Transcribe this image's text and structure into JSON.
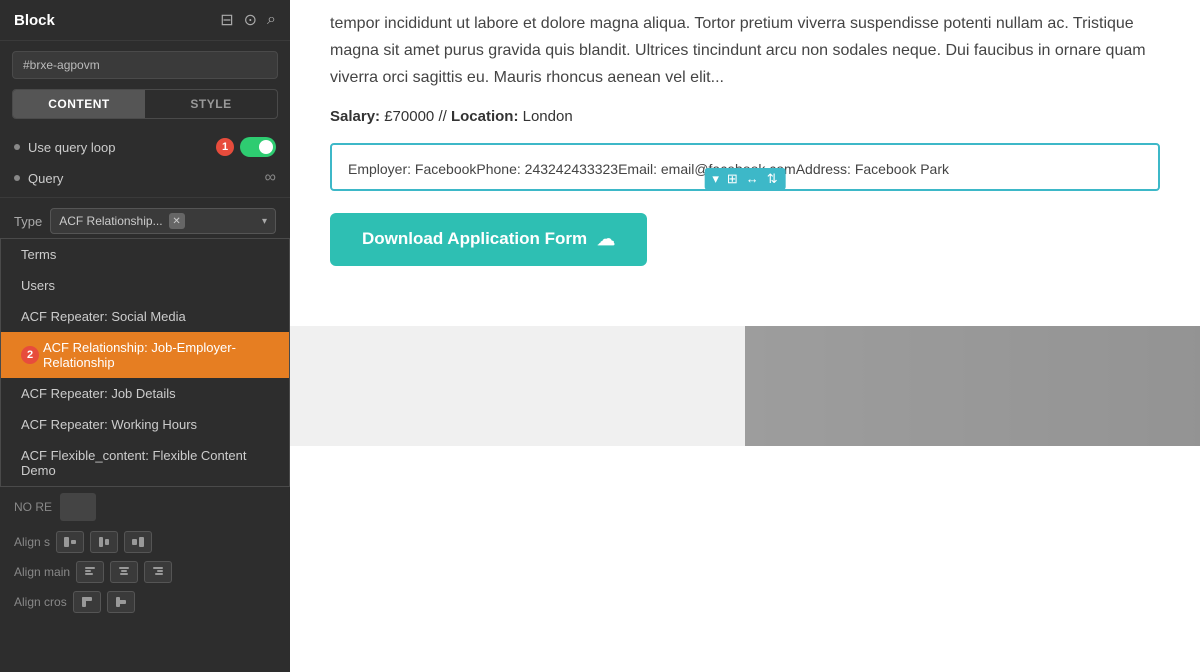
{
  "panel": {
    "title": "Block",
    "id_placeholder": "#brxe-agpovm",
    "tabs": [
      {
        "label": "CONTENT",
        "active": true
      },
      {
        "label": "STYLE",
        "active": false
      }
    ],
    "query_loop_label": "Use query loop",
    "badge1": "1",
    "query_label": "Query",
    "type_label": "Type",
    "type_value": "ACF Relationship...",
    "no_re_label": "NO RE",
    "align_self_label": "Align s",
    "align_main_label": "Align main",
    "align_cross_label": "Align cros",
    "badge2": "2"
  },
  "dropdown": {
    "items": [
      {
        "label": "Terms",
        "highlighted": false
      },
      {
        "label": "Users",
        "highlighted": false
      },
      {
        "label": "ACF Repeater: Social Media",
        "highlighted": false
      },
      {
        "label": "ACF Relationship: Job-Employer-Relationship",
        "highlighted": true
      },
      {
        "label": "ACF Repeater: Job Details",
        "highlighted": false
      },
      {
        "label": "ACF Repeater: Working Hours",
        "highlighted": false
      },
      {
        "label": "ACF Flexible_content: Flexible Content Demo",
        "highlighted": false
      }
    ]
  },
  "content": {
    "body_text": "tempor incididunt ut labore et dolore magna aliqua. Tortor pretium viverra suspendisse potenti nullam ac. Tristique magna sit amet purus gravida quis blandit. Ultrices tincindunt arcu non sodales neque. Dui faucibus in ornare quam viverra orci sagittis eu. Mauris rhoncus aenean vel elit...",
    "salary_label": "Salary:",
    "salary_value": "£70000 // ",
    "location_label": "Location:",
    "location_value": "London",
    "employer_info": "Employer: FacebookPhone: 243242433323Email: email@facebook.comAddress: Facebook Park",
    "download_btn": "Download Application Form",
    "toolbar_icons": [
      "▾",
      "⊞",
      "↔",
      "⇅"
    ]
  }
}
